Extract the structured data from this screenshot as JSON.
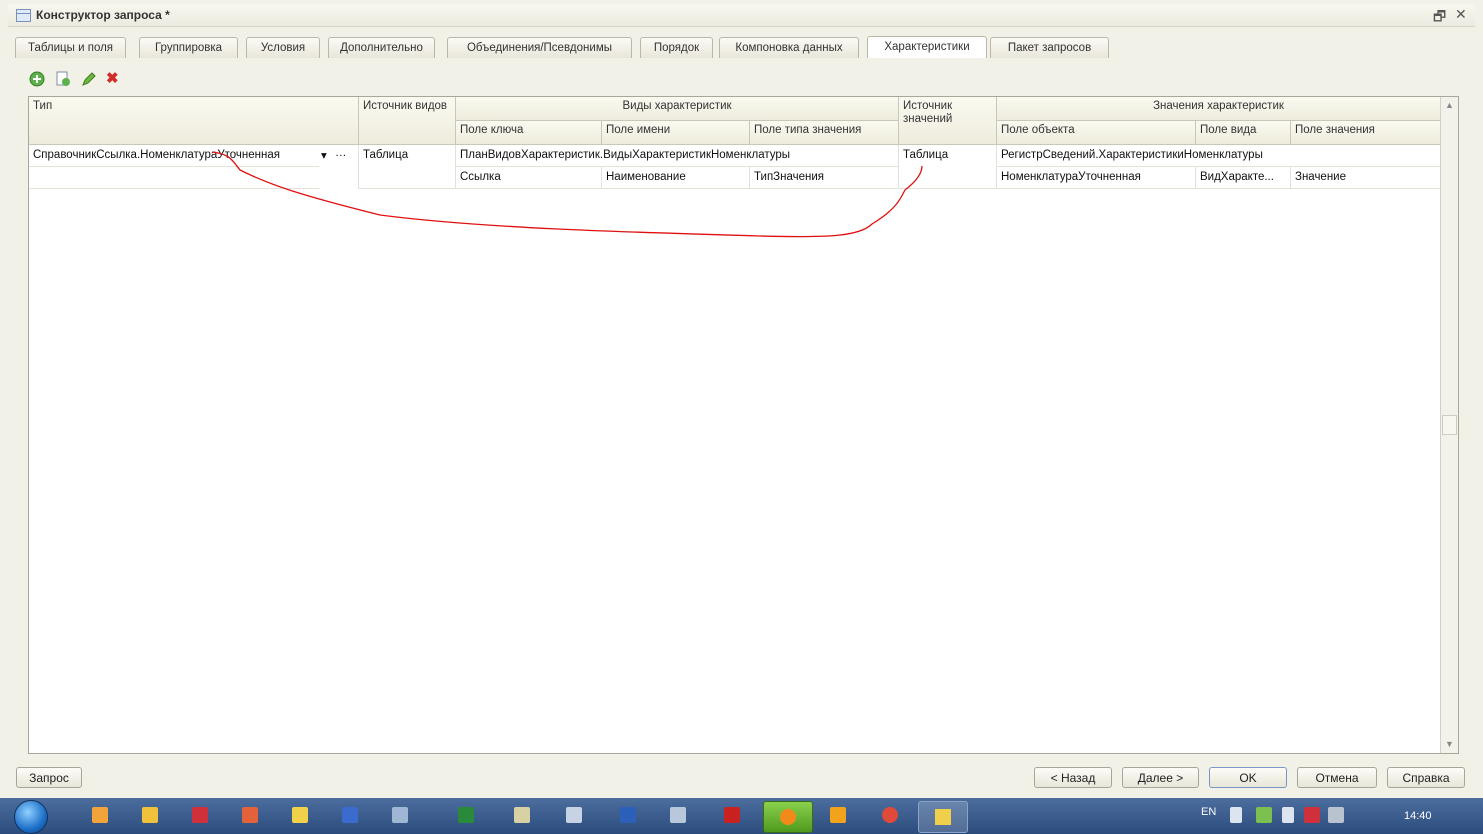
{
  "window": {
    "title": "Конструктор запроса *",
    "restore_glyph": "🗗",
    "close_glyph": "✕"
  },
  "tabs": [
    {
      "label": "Таблицы и поля",
      "active": false
    },
    {
      "label": "Группировка",
      "active": false
    },
    {
      "label": "Условия",
      "active": false
    },
    {
      "label": "Дополнительно",
      "active": false
    },
    {
      "label": "Объединения/Псевдонимы",
      "active": false
    },
    {
      "label": "Порядок",
      "active": false
    },
    {
      "label": "Компоновка данных",
      "active": false
    },
    {
      "label": "Характеристики",
      "active": true
    },
    {
      "label": "Пакет запросов",
      "active": false
    }
  ],
  "toolbar": {
    "icons": [
      "add-icon",
      "copy-icon",
      "edit-icon",
      "delete-icon"
    ],
    "delete_glyph": "✖"
  },
  "grid": {
    "headers": {
      "type": "Тип",
      "kind_source": "Источник видов",
      "kinds_group": "Виды характеристик",
      "key_field": "Поле ключа",
      "name_field": "Поле имени",
      "value_type_field": "Поле типа значения",
      "values_source": "Источник значений",
      "values_group": "Значения характеристик",
      "object_field": "Поле объекта",
      "kind_field": "Поле вида",
      "value_field": "Поле значения"
    },
    "row": {
      "type": "СправочникСсылка.НоменклатураУточненная",
      "kind_source": "Таблица",
      "kinds_table": "ПланВидовХарактеристик.ВидыХарактеристикНоменклатуры",
      "key_field": "Ссылка",
      "name_field": "Наименование",
      "value_type_field": "ТипЗначения",
      "values_source": "Таблица",
      "values_table": "РегистрСведений.ХарактеристикиНоменклатуры",
      "object_field": "НоменклатураУточненная",
      "kind_field": "ВидХаракте...",
      "value_field": "Значение"
    },
    "dropdown_glyph": "▾",
    "ellipsis_glyph": "…",
    "scroll_up": "▲",
    "scroll_down": "▼"
  },
  "buttons": {
    "query": "Запрос",
    "back": "< Назад",
    "next": "Далее >",
    "ok": "OK",
    "cancel": "Отмена",
    "help": "Справка"
  },
  "taskbar": {
    "lang": "EN",
    "time": "14:40",
    "apps": [
      "explorer-icon",
      "1c-icon",
      "kaspersky-icon",
      "remote-icon",
      "book-icon",
      "save-icon",
      "tool-icon",
      "excel-icon",
      "notepad-icon",
      "file-icon",
      "word-icon",
      "printer-icon",
      "pdf-icon",
      "orange-icon",
      "outlook-icon",
      "chrome-icon",
      "image-icon"
    ]
  },
  "colors": {
    "annotation": "#e01010",
    "accent": "#2b4c7d",
    "background": "#f2f1e8"
  }
}
